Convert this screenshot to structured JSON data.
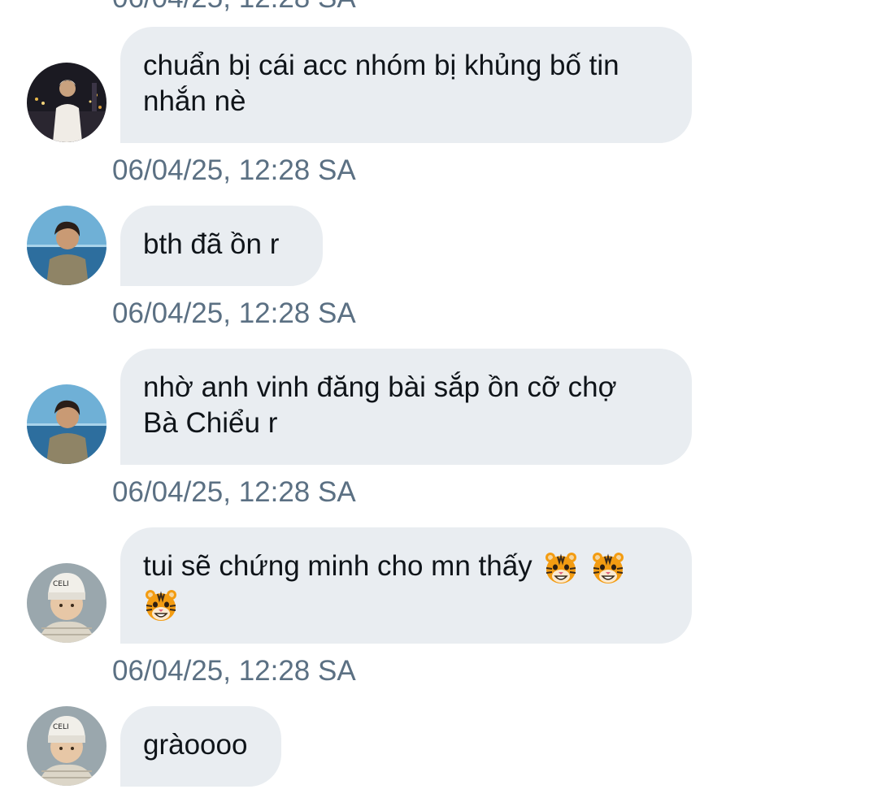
{
  "messages": [
    {
      "avatar": "avatar-night-city",
      "text_line1": "chuẩn bị cái acc nhóm bị khủng bố tin",
      "text_line2": "nhắn nè",
      "timestamp": "06/04/25, 12:28 SA"
    },
    {
      "avatar": "avatar-sea-boy",
      "text_line1": "bth đã ồn r",
      "timestamp": "06/04/25, 12:28 SA"
    },
    {
      "avatar": "avatar-sea-boy",
      "text_line1": "nhờ anh vinh đăng bài sắp ồn cỡ chợ",
      "text_line2": "Bà Chiểu r",
      "timestamp": "06/04/25, 12:28 SA"
    },
    {
      "avatar": "avatar-beanie-boy",
      "text_line1": "tui sẽ chứng minh cho mn thấy",
      "emoji": "tiger-face-emoji",
      "emoji_count": 3,
      "timestamp": "06/04/25, 12:28 SA"
    },
    {
      "avatar": "avatar-beanie-boy",
      "text_line1": "gràoooo"
    }
  ],
  "previous_timestamp": "06/04/25, 12:28 SA",
  "colors": {
    "bubble_bg": "#e9edf1",
    "text": "#0f1419",
    "timestamp": "#5b7083"
  }
}
